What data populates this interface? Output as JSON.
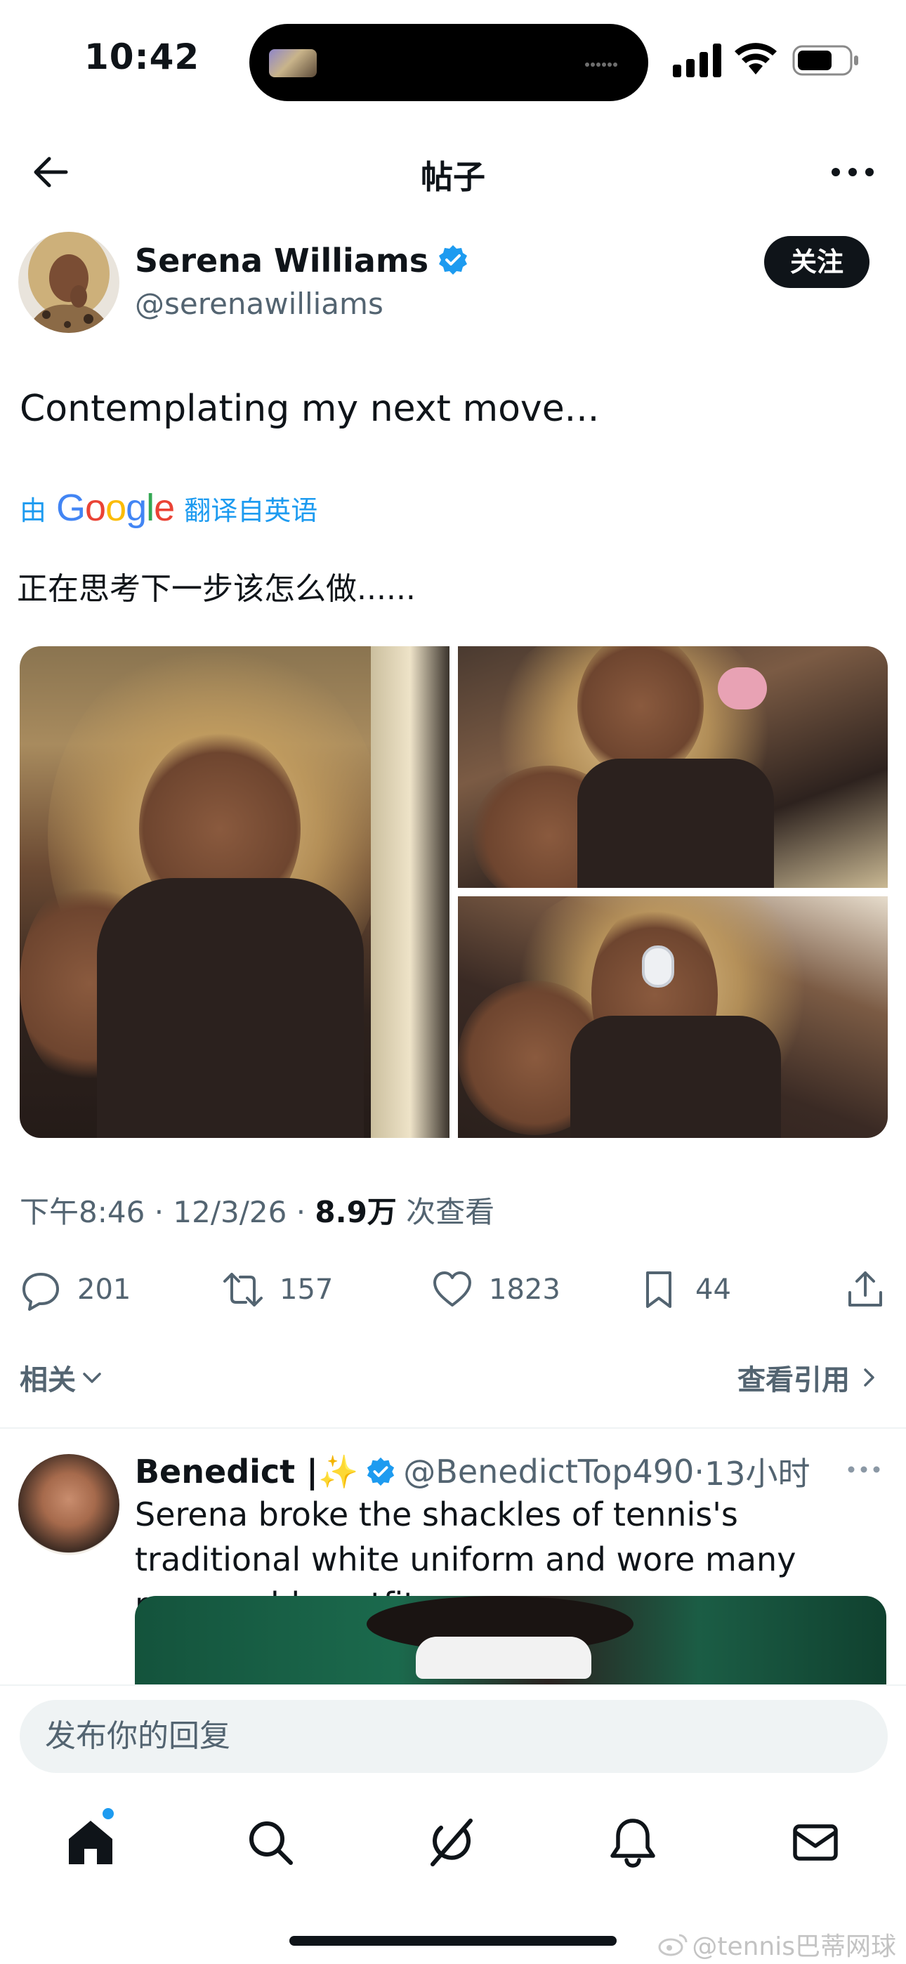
{
  "status_bar": {
    "time": "10:42"
  },
  "nav": {
    "title": "帖子"
  },
  "post": {
    "author_name": "Serena Williams",
    "author_handle": "@serenawilliams",
    "follow_label": "关注",
    "text": "Contemplating my next move...",
    "translate_prefix": "由",
    "translate_brand": "Google",
    "translate_suffix": "翻译自英语",
    "translated_text": "正在思考下一步该怎么做......",
    "time": "下午8:46",
    "date": "12/3/26",
    "separator": "·",
    "views_count": "8.9万",
    "views_label": "次查看",
    "photo_count": 3
  },
  "actions": {
    "reply_count": "201",
    "repost_count": "157",
    "like_count": "1823",
    "bookmark_count": "44"
  },
  "related_row": {
    "related_label": "相关",
    "quotes_label": "查看引用"
  },
  "reply": {
    "name": "Benedict |",
    "sparkle": "✨",
    "handle": "@BenedictTop490",
    "separator": "·",
    "time": "13小时",
    "text": "Serena broke the shackles of tennis's traditional white uniform and wore many memorable outfits."
  },
  "composer": {
    "placeholder": "发布你的回复"
  },
  "tabbar": {
    "items": [
      "home-icon",
      "search-icon",
      "grok-icon",
      "notifications-icon",
      "messages-icon"
    ],
    "home_has_badge": true
  },
  "watermark": {
    "text": "@tennis巴蒂网球"
  },
  "colors": {
    "accent": "#1d9bf0",
    "text_primary": "#0f1419",
    "text_secondary": "#536471",
    "button_dark": "#0f1419"
  }
}
